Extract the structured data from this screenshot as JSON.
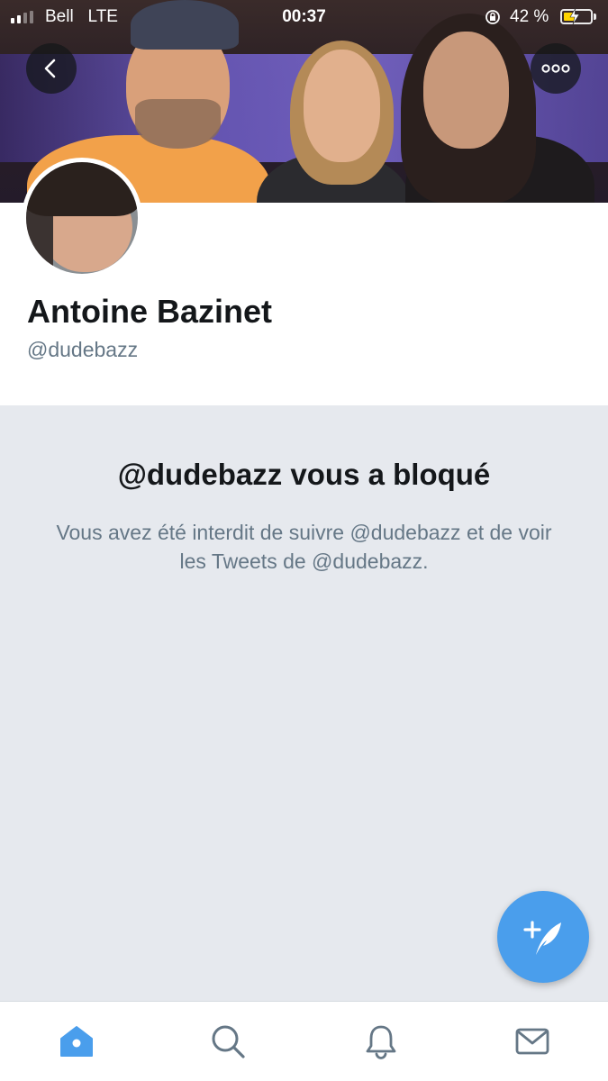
{
  "status_bar": {
    "carrier": "Bell",
    "network": "LTE",
    "time": "00:37",
    "battery_percent": "42 %",
    "battery_level": 0.42,
    "signal_bars_active": 2,
    "signal_bars_total": 4
  },
  "header": {
    "back_icon": "chevron-left-icon",
    "more_icon": "more-horizontal-icon"
  },
  "profile": {
    "display_name": "Antoine Bazinet",
    "handle": "@dudebazz"
  },
  "blocked": {
    "title": "@dudebazz vous a bloqué",
    "message": "Vous avez été interdit de suivre @dudebazz et de voir les Tweets de @dudebazz."
  },
  "fab": {
    "icon": "compose-tweet-icon"
  },
  "tabs": [
    {
      "id": "home",
      "icon": "home-icon",
      "active": true
    },
    {
      "id": "search",
      "icon": "search-icon",
      "active": false
    },
    {
      "id": "notifications",
      "icon": "bell-icon",
      "active": false
    },
    {
      "id": "messages",
      "icon": "envelope-icon",
      "active": false
    }
  ],
  "colors": {
    "accent": "#4a9eec",
    "text_primary": "#14171a",
    "text_secondary": "#657786",
    "background": "#e6e9ee"
  }
}
